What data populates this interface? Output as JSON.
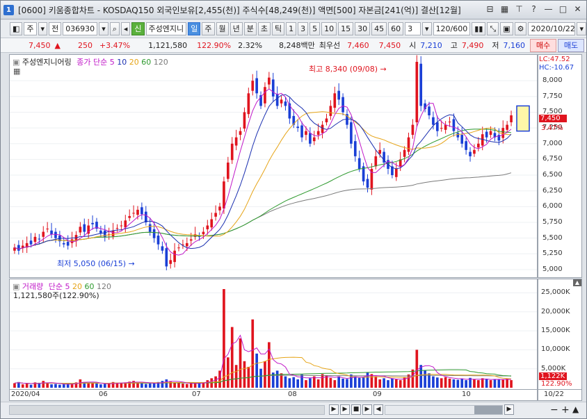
{
  "window": {
    "icon_label": "1",
    "title": "[0600] 키움종합차트 - KOSDAQ150 외국인보유[2,455(천)] 주식수[48,249(천)] 액면[500] 자본금[241(억)] 결산[12월]"
  },
  "toolbar": {
    "type_label": "주",
    "jeon_label": "전",
    "code": "036930",
    "sin_badge": "신",
    "name": "주성엔지니",
    "periods": [
      "일",
      "주",
      "월",
      "년",
      "분",
      "초",
      "틱"
    ],
    "active_period": "일",
    "numbers": [
      "1",
      "3",
      "5",
      "10",
      "15",
      "30",
      "45",
      "60"
    ],
    "custom_num": "3",
    "count": "120/600",
    "date": "2020/10/22"
  },
  "quote": {
    "price": "7,450",
    "change": "250",
    "change_pct": "+3.47%",
    "volume": "1,121,580",
    "vol_ratio": "122.90%",
    "turnover": "2.32%",
    "amount": "8,248백만",
    "priority_label": "최우선",
    "bid": "7,460",
    "ask": "7,450",
    "open_label": "시",
    "open": "7,210",
    "high_label": "고",
    "high": "7,490",
    "low_label": "저",
    "low": "7,160",
    "buy_label": "매수",
    "sell_label": "매도"
  },
  "price_pane": {
    "name": "주성엔지니어링",
    "ma_label": "종가 단순",
    "ma": [
      "5",
      "10",
      "20",
      "60",
      "120"
    ],
    "lc": "LC:47.52",
    "hc": "HC:-10.67",
    "high_note": "최고 8,340 (09/08)",
    "low_note": "최저 5,050 (06/15)",
    "last_price": "7,450",
    "last_pct": "3.47%",
    "ticks": [
      "8,000",
      "7,750",
      "7,500",
      "7,250",
      "7,000",
      "6,750",
      "6,500",
      "6,250",
      "6,000",
      "5,750",
      "5,500",
      "5,250",
      "5,000"
    ]
  },
  "volume_pane": {
    "name": "거래량",
    "ma_label": "단순",
    "ma": [
      "5",
      "20",
      "60",
      "120"
    ],
    "value_text": "1,121,580주(122.90%)",
    "ticks": [
      "25,000K",
      "20,000K",
      "15,000K",
      "10,000K",
      "5,000K"
    ],
    "last_vol": "1,122K",
    "last_pct": "122.90%"
  },
  "xaxis": {
    "labels": [
      "2020/04",
      "06",
      "07",
      "08",
      "09",
      "10"
    ],
    "end_label": "10/22"
  },
  "colors": {
    "up": "#e0141e",
    "down": "#1a3fd6",
    "ma5": "#c018c8",
    "ma10": "#1a2fb0",
    "ma20": "#e6a417",
    "ma60": "#2e9a2e",
    "ma120": "#7a7a7a"
  },
  "chart_data": {
    "type": "candlestick",
    "price_range": [
      4900,
      8300
    ],
    "volume_range": [
      0,
      26000
    ],
    "volume_unit": "K",
    "close": [
      5350,
      5300,
      5380,
      5420,
      5400,
      5520,
      5480,
      5600,
      5650,
      5560,
      5500,
      5450,
      5400,
      5380,
      5480,
      5550,
      5680,
      5600,
      5700,
      5720,
      5650,
      5580,
      5520,
      5560,
      5620,
      5660,
      5700,
      5780,
      5850,
      5900,
      5950,
      5880,
      5750,
      5600,
      5500,
      5400,
      5300,
      5050,
      5150,
      5300,
      5350,
      5400,
      5420,
      5480,
      5560,
      5520,
      5600,
      5700,
      5800,
      5900,
      6000,
      6400,
      6700,
      7000,
      7100,
      7200,
      7500,
      7800,
      8000,
      7800,
      7600,
      7900,
      8050,
      7750,
      7600,
      7700,
      7600,
      7400,
      7300,
      7250,
      7100,
      7200,
      7000,
      7100,
      7200,
      7300,
      7400,
      7600,
      7800,
      7700,
      7500,
      7300,
      7000,
      6800,
      6600,
      6400,
      6300,
      6600,
      6800,
      6900,
      6700,
      6600,
      6500,
      6600,
      6750,
      6900,
      7100,
      7300,
      8300,
      7600,
      7550,
      7450,
      7300,
      7200,
      7250,
      7300,
      7350,
      7200,
      7100,
      7000,
      6900,
      6800,
      6900,
      7000,
      7150,
      7100,
      7200,
      7100,
      7050,
      7250,
      7300,
      7450
    ],
    "volume_k": [
      1200,
      1500,
      900,
      1100,
      800,
      1400,
      1300,
      1800,
      1200,
      900,
      1000,
      800,
      900,
      1100,
      1000,
      1400,
      2200,
      1500,
      1300,
      1200,
      1100,
      900,
      1000,
      1100,
      1500,
      1300,
      1200,
      1400,
      1600,
      1800,
      1400,
      1200,
      1000,
      1100,
      1300,
      1500,
      1800,
      2200,
      1600,
      1400,
      1200,
      1100,
      1000,
      1200,
      1300,
      1200,
      1400,
      2000,
      2500,
      3000,
      4500,
      26000,
      8000,
      16000,
      6000,
      13000,
      7000,
      5500,
      18000,
      9000,
      5000,
      7000,
      12000,
      4000,
      4500,
      3800,
      3000,
      2500,
      2800,
      2200,
      3500,
      2000,
      2500,
      3000,
      2200,
      3600,
      3200,
      2600,
      2000,
      3000,
      2400,
      2300,
      3500,
      3000,
      2600,
      2800,
      4000,
      3600,
      3000,
      2200,
      2500,
      2000,
      2500,
      2200,
      2000,
      2800,
      3500,
      4800,
      10000,
      6000,
      4500,
      3800,
      3000,
      2700,
      2500,
      2800,
      2400,
      2200,
      2100,
      2400,
      2000,
      2600,
      2200,
      2000,
      2500,
      2200,
      2000,
      2300,
      2100,
      2200,
      2400,
      2000
    ]
  }
}
